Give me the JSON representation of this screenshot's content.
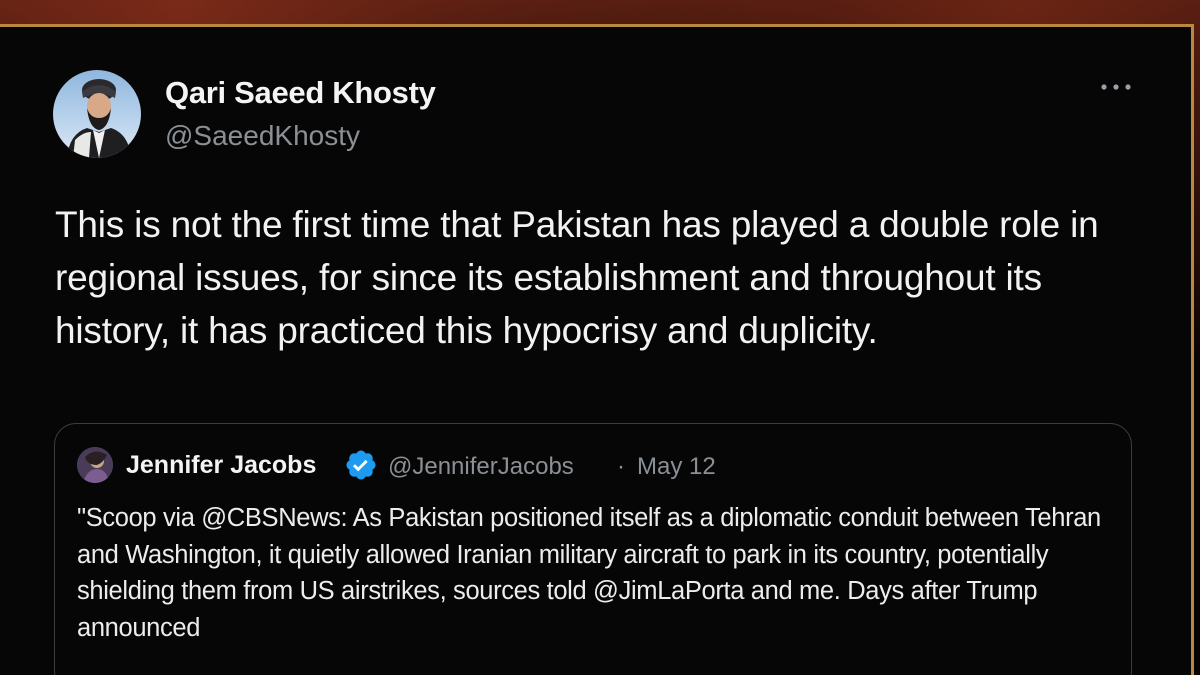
{
  "tweet": {
    "author": {
      "name": "Qari Saeed Khosty",
      "handle": "@SaeedKhosty"
    },
    "more_icon": "more-horizontal-icon",
    "text": "This is not the first time that Pakistan has played a double role in regional issues, for since its establishment and throughout its history, it has practiced this hypocrisy and duplicity."
  },
  "quote": {
    "author": {
      "name": "Jennifer Jacobs",
      "verified": true,
      "handle": "@JenniferJacobs",
      "separator": "·",
      "date": "May 12"
    },
    "text": "\"Scoop via @CBSNews: As Pakistan positioned itself as a diplomatic conduit between Tehran and Washington, it quietly allowed Iranian military aircraft to park in its country, potentially shielding them from US airstrikes, sources told @JimLaPorta and me. Days after Trump announced"
  },
  "colors": {
    "background": "#060606",
    "frame_border": "#b8893e",
    "text_primary": "#f2f2f2",
    "text_secondary": "#8b9096",
    "verified_badge": "#1d9bf0",
    "quote_border": "#3a3d42"
  }
}
